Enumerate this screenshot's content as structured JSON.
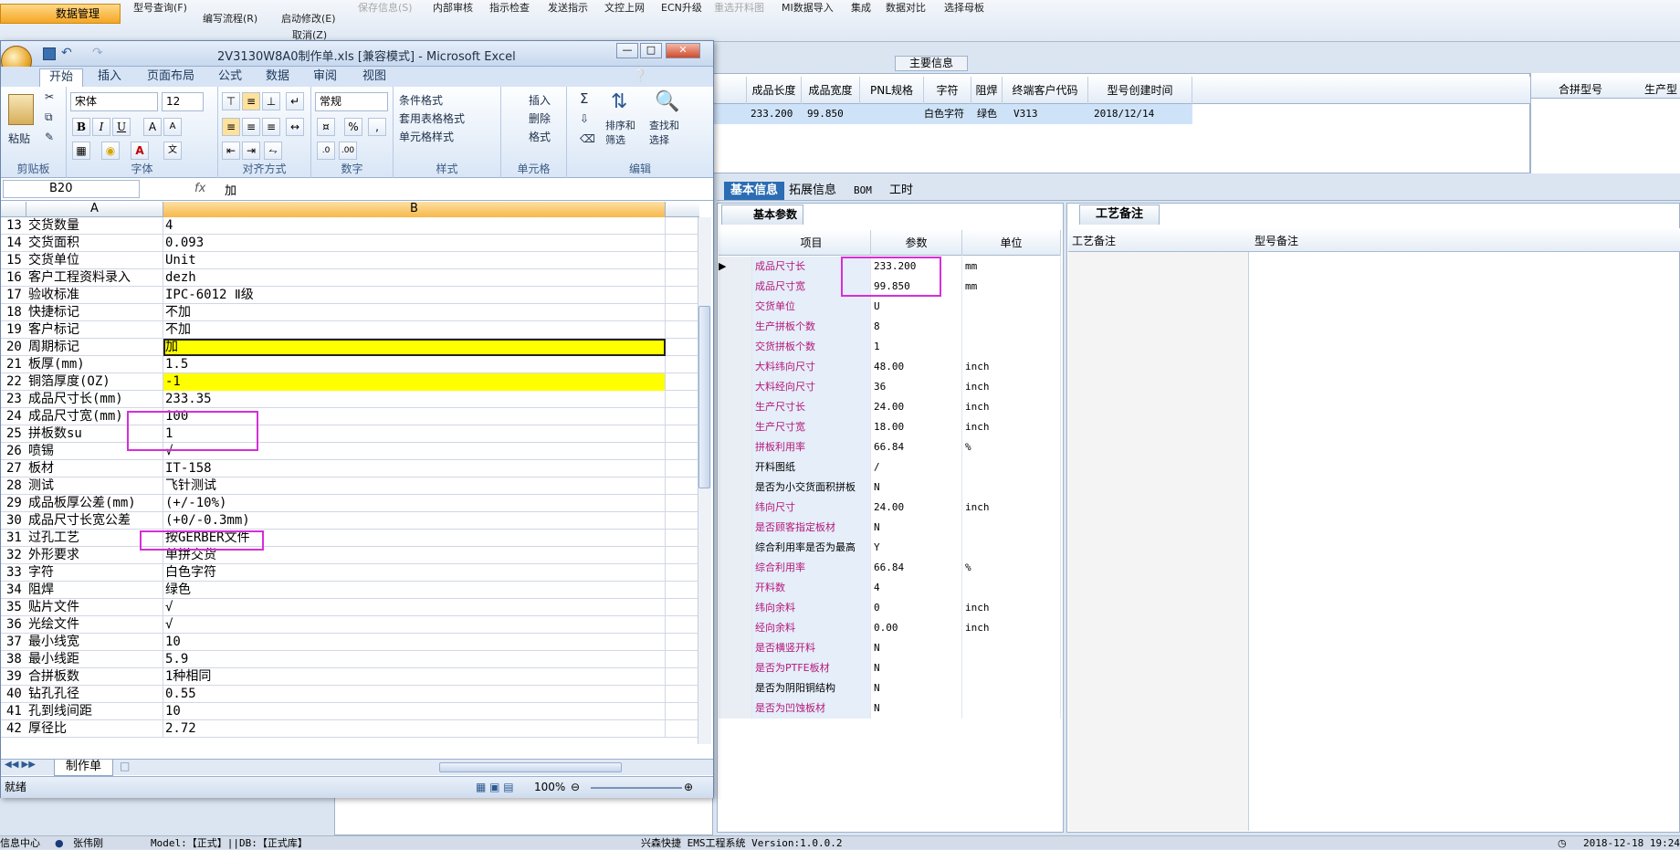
{
  "erp": {
    "nav_label": "数据管理",
    "toolbar": [
      "型号查询(F)",
      "编写流程(R)",
      "启动修改(E)",
      "保存信息(S)",
      "内部审核",
      "指示检查",
      "发送指示",
      "文控上网",
      "ECN升级",
      "重选开料图",
      "MI数据导入",
      "集成",
      "数据对比",
      "选择母板"
    ],
    "toolbar_sub": "取消(Z)",
    "main_info_label": "主要信息",
    "grid_headers": [
      "成品长度",
      "成品宽度",
      "PNL规格",
      "字符",
      "阻焊",
      "终端客户代码",
      "型号创建时间"
    ],
    "grid_row": [
      "233.200",
      "99.850",
      "",
      "白色字符",
      "绿色",
      "V313",
      "2018/12/14"
    ],
    "right_headers": [
      "合拼型号",
      "生产型"
    ],
    "tabs": [
      "基本信息",
      "拓展信息",
      "BOM",
      "工时"
    ],
    "param_tab": "基本参数",
    "param_headers": [
      "项目",
      "参数",
      "单位"
    ],
    "params": [
      {
        "k": "成品尺寸长",
        "v": "233.200",
        "u": "mm",
        "mag": true
      },
      {
        "k": "成品尺寸宽",
        "v": "99.850",
        "u": "mm",
        "mag": true
      },
      {
        "k": "交货单位",
        "v": "U",
        "u": "",
        "mag": true
      },
      {
        "k": "生产拼板个数",
        "v": "8",
        "u": "",
        "mag": true
      },
      {
        "k": "交货拼板个数",
        "v": "1",
        "u": "",
        "mag": true
      },
      {
        "k": "大料纬向尺寸",
        "v": "48.00",
        "u": "inch",
        "mag": true
      },
      {
        "k": "大料经向尺寸",
        "v": "36",
        "u": "inch",
        "mag": true
      },
      {
        "k": "生产尺寸长",
        "v": "24.00",
        "u": "inch",
        "mag": true
      },
      {
        "k": "生产尺寸宽",
        "v": "18.00",
        "u": "inch",
        "mag": true
      },
      {
        "k": "拼板利用率",
        "v": "66.84",
        "u": "%",
        "mag": true
      },
      {
        "k": "开料图纸",
        "v": "/",
        "u": "",
        "mag": false
      },
      {
        "k": "是否为小交货面积拼板",
        "v": "N",
        "u": "",
        "mag": false
      },
      {
        "k": "纬向尺寸",
        "v": "24.00",
        "u": "inch",
        "mag": true
      },
      {
        "k": "是否顾客指定板材",
        "v": "N",
        "u": "",
        "mag": true
      },
      {
        "k": "综合利用率是否为最高",
        "v": "Y",
        "u": "",
        "mag": false
      },
      {
        "k": "综合利用率",
        "v": "66.84",
        "u": "%",
        "mag": true
      },
      {
        "k": "开料数",
        "v": "4",
        "u": "",
        "mag": true
      },
      {
        "k": "纬向余料",
        "v": "0",
        "u": "inch",
        "mag": true
      },
      {
        "k": "经向余料",
        "v": "0.00",
        "u": "inch",
        "mag": true
      },
      {
        "k": "是否横竖开料",
        "v": "N",
        "u": "",
        "mag": true
      },
      {
        "k": "是否为PTFE板材",
        "v": "N",
        "u": "",
        "mag": true
      },
      {
        "k": "是否为阴阳铜结构",
        "v": "N",
        "u": "",
        "mag": false
      },
      {
        "k": "是否为凹蚀板材",
        "v": "N",
        "u": "",
        "mag": true
      }
    ],
    "notes_tab": "工艺备注",
    "notes_headers": [
      "工艺备注",
      "型号备注"
    ],
    "status": [
      "信息中心",
      "张伟刚",
      "Model:【正式】||DB:【正式库】",
      "兴森快捷 EMS工程系统 Version:1.0.0.2",
      "2018-12-18 19:24"
    ]
  },
  "excel": {
    "title": "2V3130W8A0制作单.xls  [兼容模式] - Microsoft Excel",
    "tabs": [
      "开始",
      "插入",
      "页面布局",
      "公式",
      "数据",
      "审阅",
      "视图"
    ],
    "font_name": "宋体",
    "font_size": "12",
    "number_format": "常规",
    "paste": "粘贴",
    "group_labels": [
      "剪贴板",
      "字体",
      "对齐方式",
      "数字",
      "样式",
      "单元格",
      "编辑"
    ],
    "style_btns": [
      "条件格式",
      "套用表格格式",
      "单元格样式"
    ],
    "cell_btns": [
      "插入",
      "删除",
      "格式"
    ],
    "edit_btns": [
      "排序和筛选",
      "查找和选择"
    ],
    "namebox": "B20",
    "formula": "加",
    "col_headers": [
      "A",
      "B"
    ],
    "rows": [
      {
        "n": "13",
        "a": "交货数量",
        "b": "4"
      },
      {
        "n": "14",
        "a": "交货面积",
        "b": "0.093"
      },
      {
        "n": "15",
        "a": "交货单位",
        "b": "Unit"
      },
      {
        "n": "16",
        "a": "客户工程资料录入",
        "b": "dezh"
      },
      {
        "n": "17",
        "a": "验收标准",
        "b": "IPC-6012 Ⅱ级"
      },
      {
        "n": "18",
        "a": "快捷标记",
        "b": "不加"
      },
      {
        "n": "19",
        "a": "客户标记",
        "b": "不加"
      },
      {
        "n": "20",
        "a": "周期标记",
        "b": "加",
        "hl": true,
        "sel": true
      },
      {
        "n": "21",
        "a": "板厚(mm)",
        "b": "1.5"
      },
      {
        "n": "22",
        "a": "铜箔厚度(OZ)",
        "b": "-1",
        "hl": true
      },
      {
        "n": "23",
        "a": "成品尺寸长(mm)",
        "b": "233.35"
      },
      {
        "n": "24",
        "a": "成品尺寸宽(mm)",
        "b": "100"
      },
      {
        "n": "25",
        "a": "拼板数su",
        "b": "1"
      },
      {
        "n": "26",
        "a": "喷锡",
        "b": "√"
      },
      {
        "n": "27",
        "a": "板材",
        "b": "IT-158"
      },
      {
        "n": "28",
        "a": "测试",
        "b": "飞针测试"
      },
      {
        "n": "29",
        "a": "成品板厚公差(mm)",
        "b": "(+/-10%)"
      },
      {
        "n": "30",
        "a": "成品尺寸长宽公差",
        "b": "(+0/-0.3mm)"
      },
      {
        "n": "31",
        "a": "过孔工艺",
        "b": "按GERBER文件"
      },
      {
        "n": "32",
        "a": "外形要求",
        "b": "单拼交货"
      },
      {
        "n": "33",
        "a": "字符",
        "b": "白色字符"
      },
      {
        "n": "34",
        "a": "阻焊",
        "b": "绿色"
      },
      {
        "n": "35",
        "a": "贴片文件",
        "b": "√"
      },
      {
        "n": "36",
        "a": "光绘文件",
        "b": "√"
      },
      {
        "n": "37",
        "a": "最小线宽",
        "b": "10"
      },
      {
        "n": "38",
        "a": "最小线距",
        "b": "5.9"
      },
      {
        "n": "39",
        "a": "合拼板数",
        "b": "1种相同"
      },
      {
        "n": "40",
        "a": "钻孔孔径",
        "b": "0.55"
      },
      {
        "n": "41",
        "a": "孔到线间距",
        "b": "10"
      },
      {
        "n": "42",
        "a": "厚径比",
        "b": "2.72"
      }
    ],
    "sheet_tab": "制作单",
    "status_ready": "就绪",
    "zoom": "100%"
  }
}
